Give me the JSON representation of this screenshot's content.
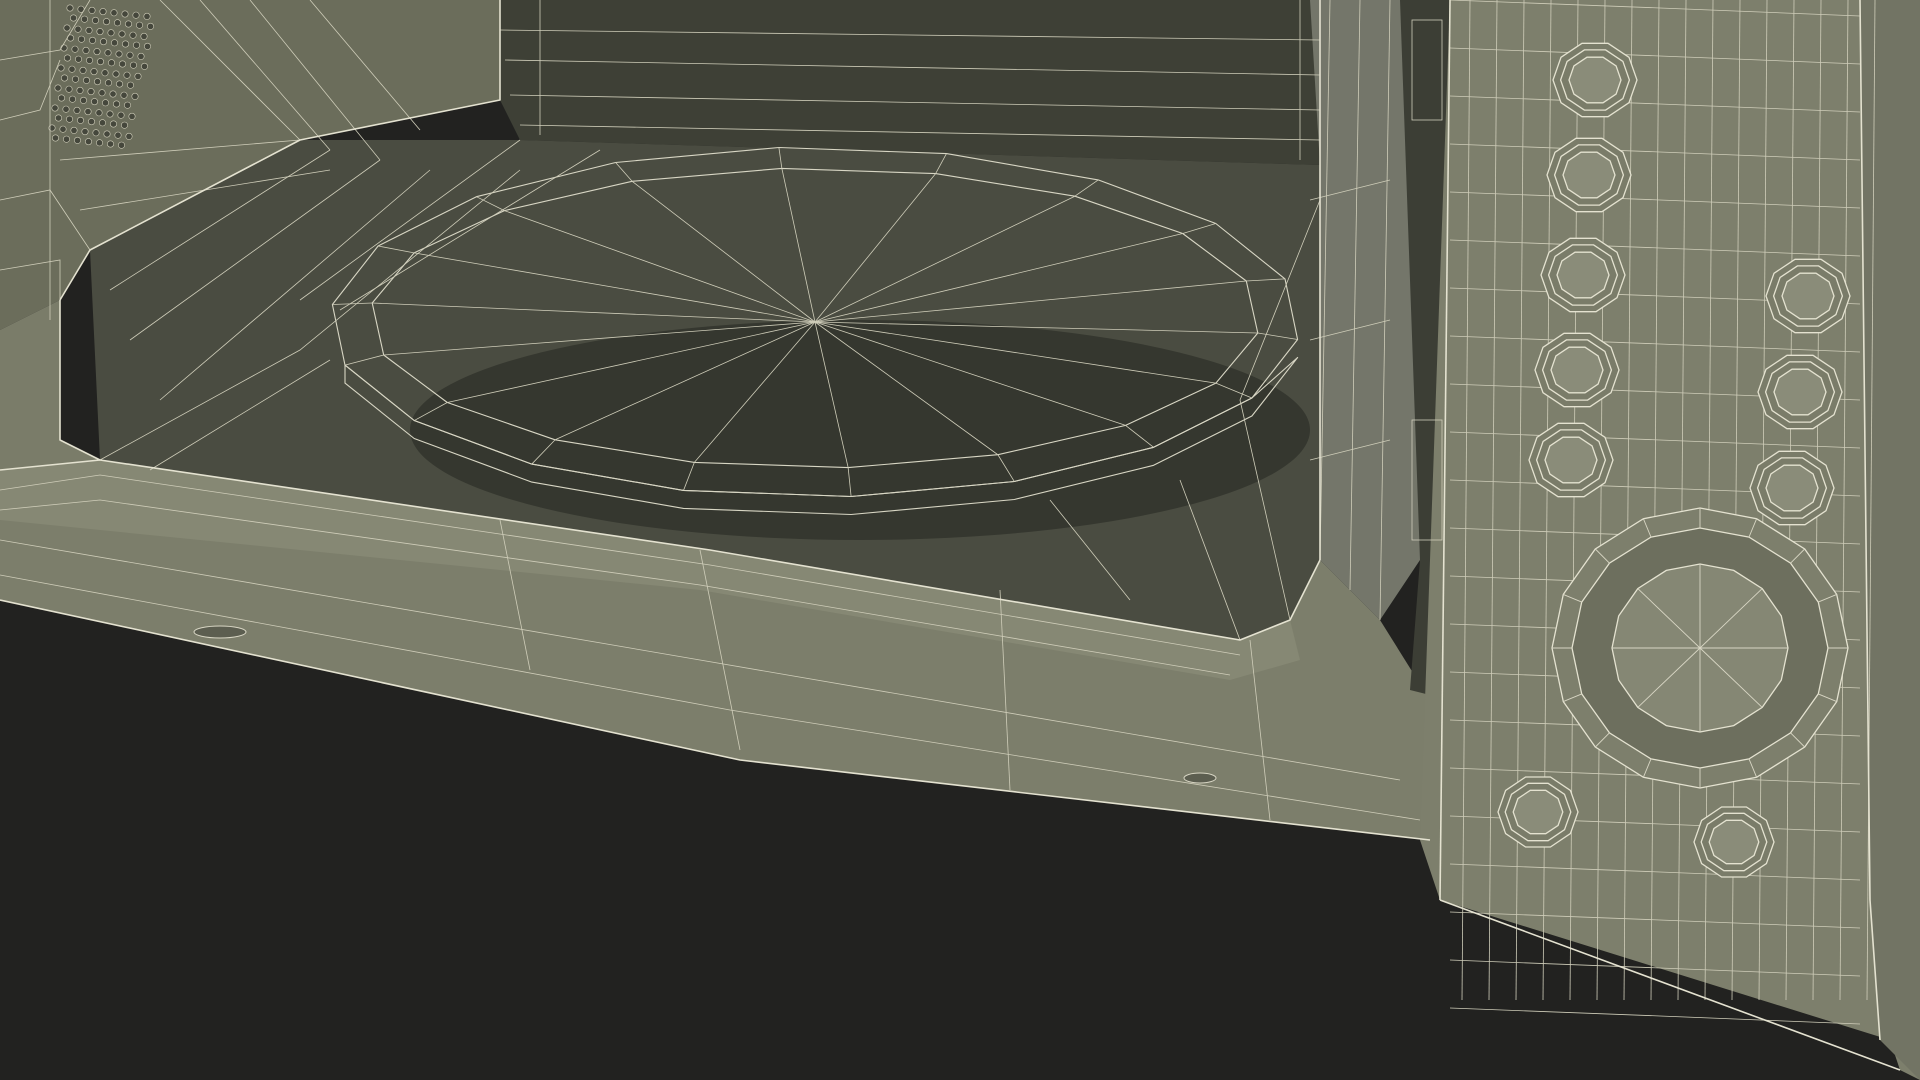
{
  "image": {
    "subject": "microwave-oven-wireframe",
    "render_style": "3d-wireframe-over-shaded-mesh",
    "colors": {
      "background": "#222220",
      "body_shade": "#7a7c69",
      "body_light": "#8a8c79",
      "interior_dark": "#3b3d33",
      "interior_mid": "#53554a",
      "turntable": "#45473c",
      "wire": "#d8d6c4"
    },
    "control_panel": {
      "left_column_buttons": 5,
      "right_column_buttons": 3,
      "bottom_buttons": 2,
      "dial_segments": 8
    },
    "turntable": {
      "sides": 18
    }
  }
}
